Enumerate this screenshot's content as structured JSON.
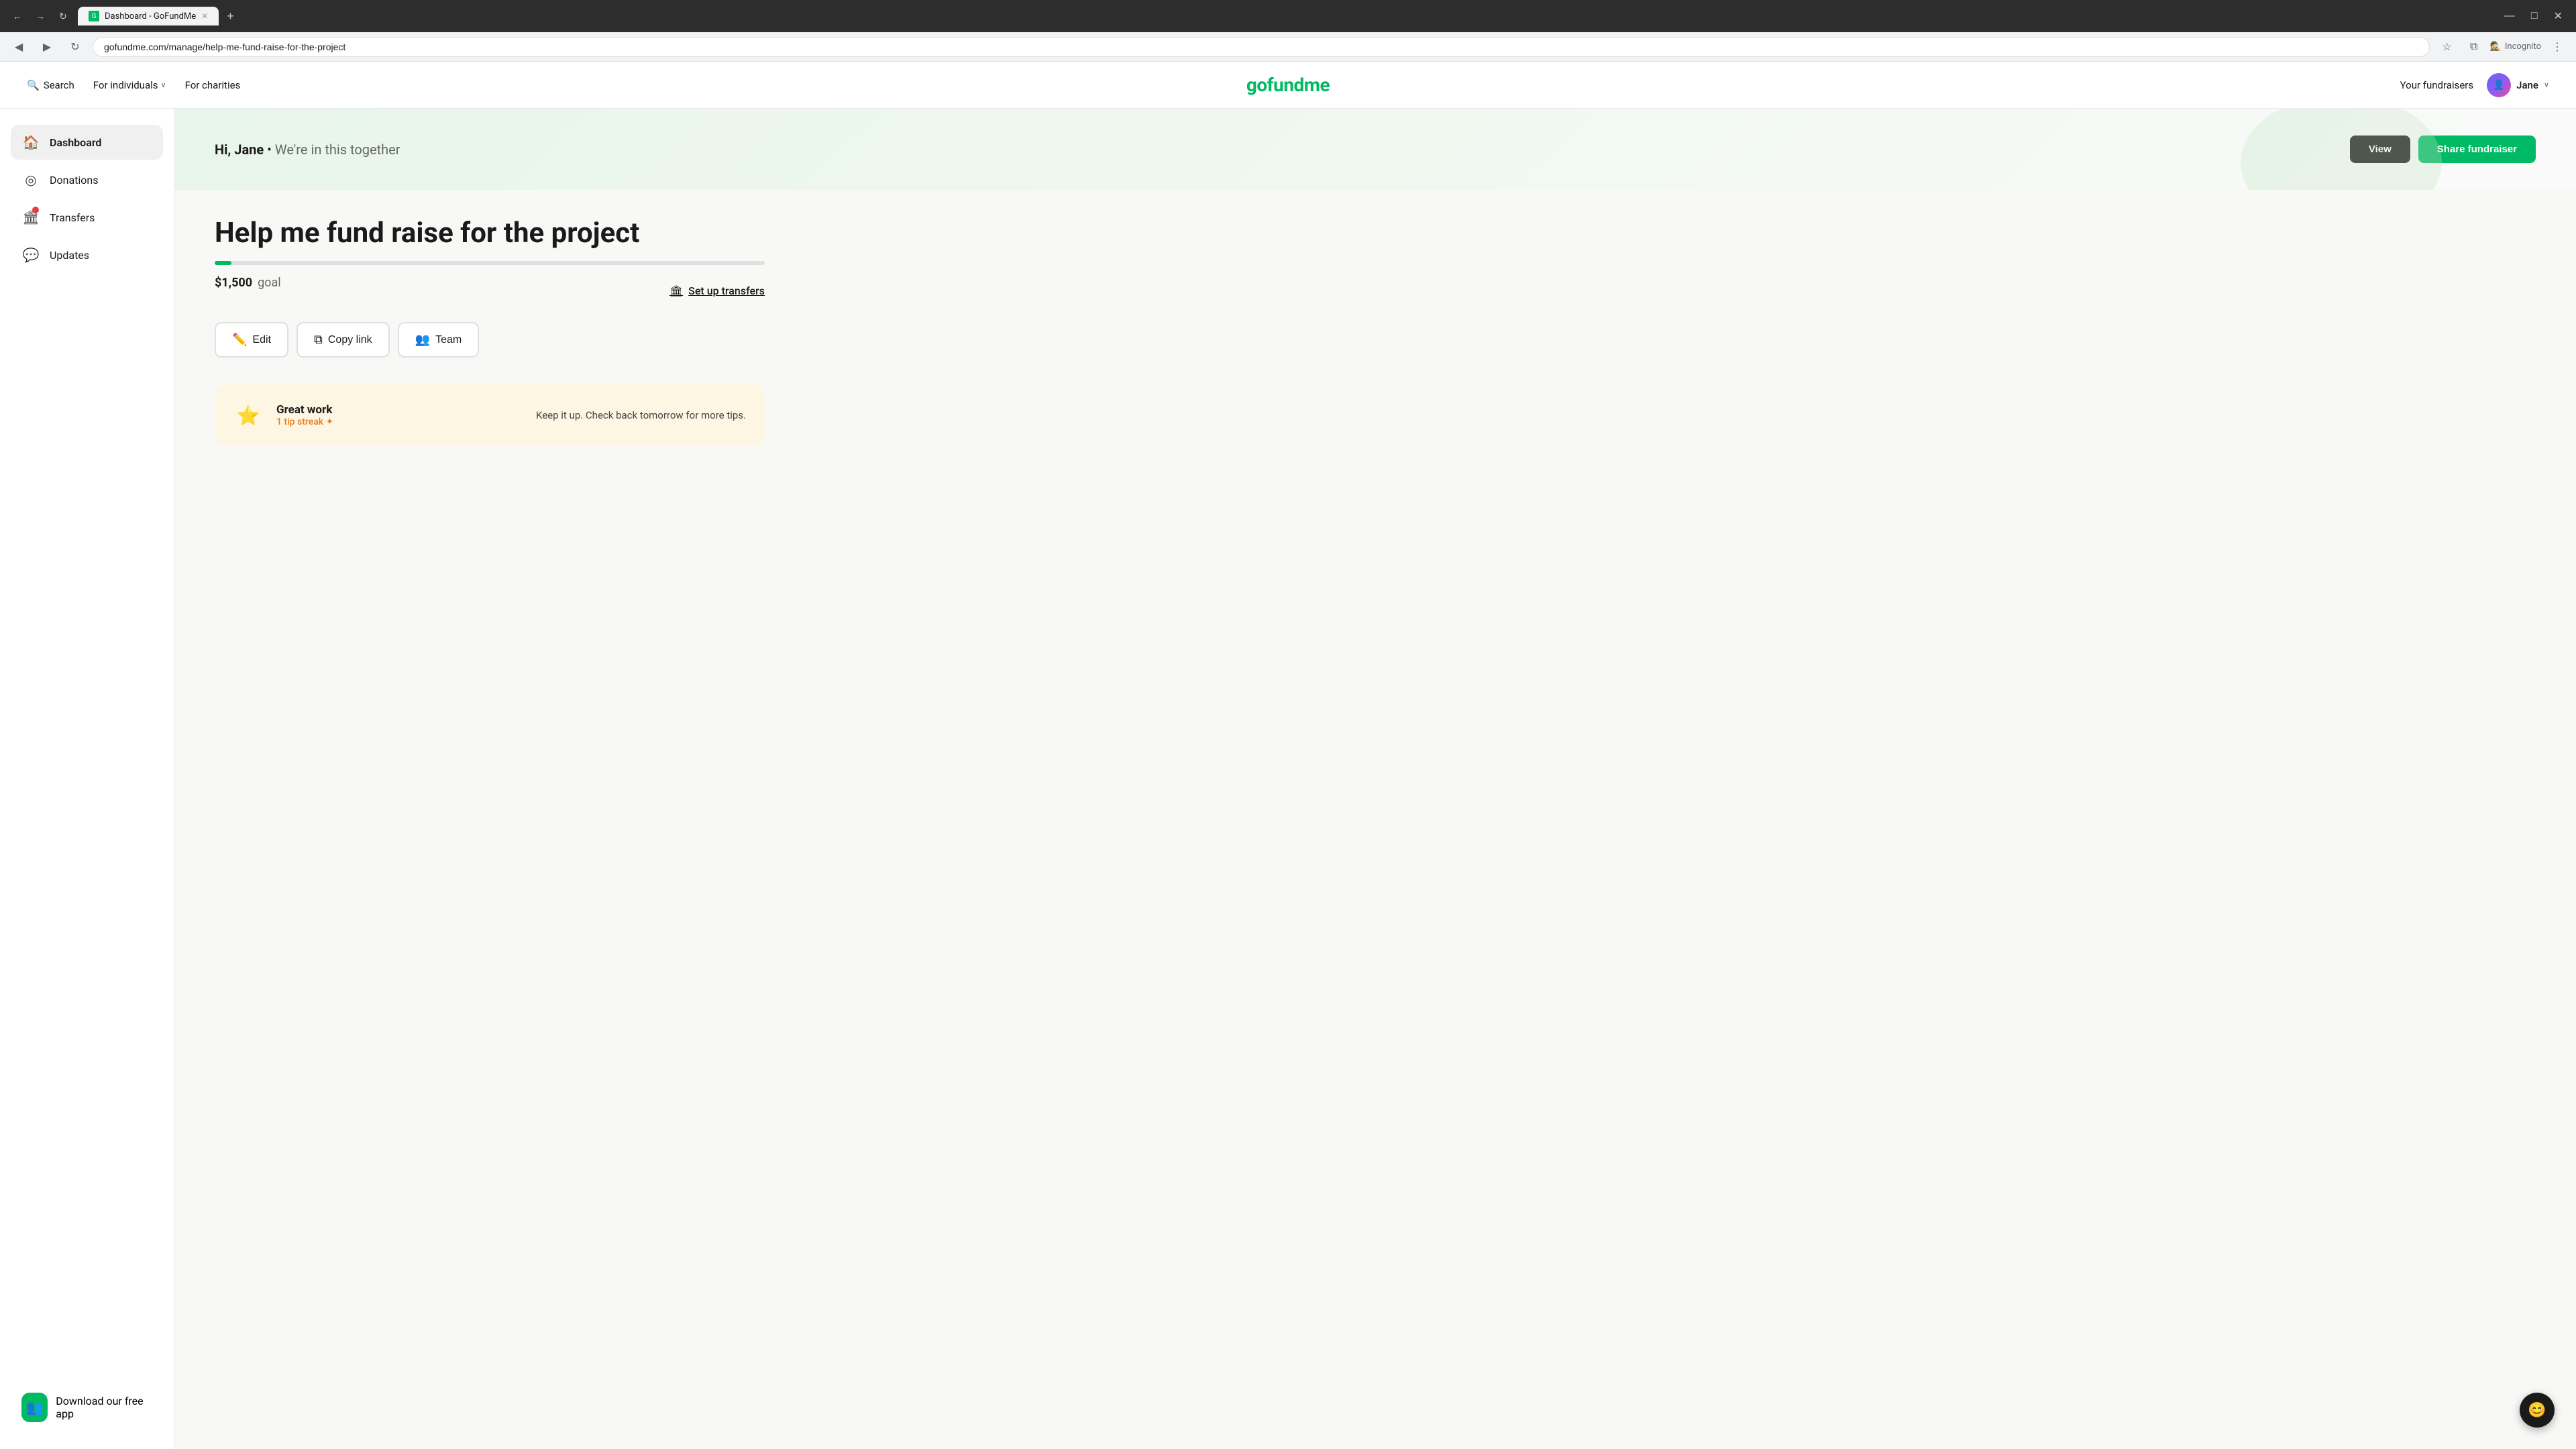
{
  "browser": {
    "tab_title": "Dashboard - GoFundMe",
    "tab_favicon": "G",
    "address": "gofundme.com/manage/help-me-fund-raise-for-the-project",
    "incognito_label": "Incognito",
    "new_tab_label": "+",
    "back_btn": "←",
    "forward_btn": "→",
    "refresh_btn": "↻",
    "bookmark_icon": "☆",
    "window_icon": "⧉",
    "minimize_label": "—",
    "maximize_label": "□",
    "close_label": "✕",
    "close_tab_label": "✕"
  },
  "header": {
    "search_label": "Search",
    "for_individuals_label": "For individuals",
    "for_charities_label": "For charities",
    "logo_text": "gofundme",
    "your_fundraisers_label": "Your fundraisers",
    "user_name": "Jane",
    "chevron": "∨"
  },
  "sidebar": {
    "items": [
      {
        "id": "dashboard",
        "label": "Dashboard",
        "icon": "🏠",
        "active": true
      },
      {
        "id": "donations",
        "label": "Donations",
        "icon": "⊙",
        "active": false
      },
      {
        "id": "transfers",
        "label": "Transfers",
        "icon": "🏦",
        "active": false,
        "has_dot": true
      },
      {
        "id": "updates",
        "label": "Updates",
        "icon": "💬",
        "active": false
      }
    ],
    "download_label": "Download our free app"
  },
  "dashboard": {
    "greeting": "Hi, Jane",
    "greeting_separator": "•",
    "greeting_sub": "We're in this together",
    "view_btn": "View",
    "share_btn": "Share fundraiser"
  },
  "fundraiser": {
    "title": "Help me fund raise for the project",
    "goal_amount": "$1,500",
    "goal_label": "goal",
    "progress_percent": 3,
    "setup_transfers_label": "Set up transfers",
    "edit_btn": "Edit",
    "copy_link_btn": "Copy link",
    "team_btn": "Team"
  },
  "tip_card": {
    "title": "Great work",
    "streak_label": "1 tip streak ✦",
    "body": "Keep it up. Check back tomorrow for more tips."
  }
}
